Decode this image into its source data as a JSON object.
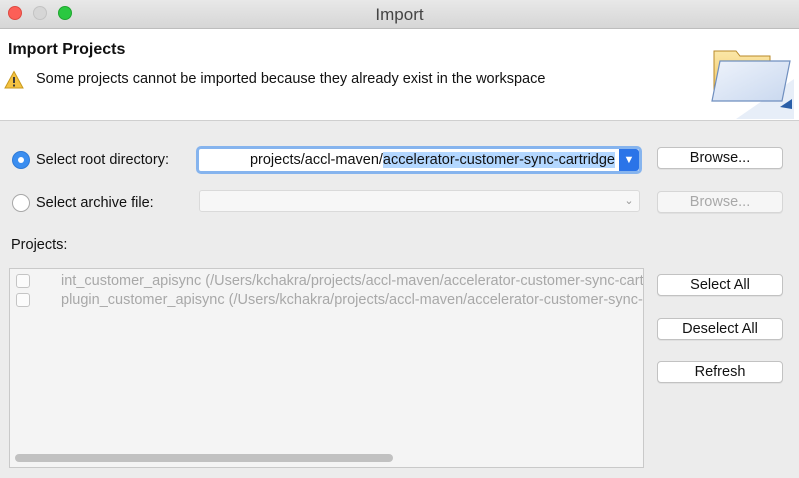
{
  "window": {
    "title": "Import"
  },
  "header": {
    "title": "Import Projects",
    "message": "Some projects cannot be imported because they already exist in the workspace"
  },
  "root_dir": {
    "label": "Select root directory:",
    "value_prefix": "projects/accl-maven/",
    "value_selected": "accelerator-customer-sync-cartridge",
    "browse": "Browse..."
  },
  "archive": {
    "label": "Select archive file:",
    "value": "",
    "browse": "Browse..."
  },
  "projects": {
    "label": "Projects:",
    "rows": [
      "int_customer_apisync (/Users/kchakra/projects/accl-maven/accelerator-customer-sync-cartridge)",
      "plugin_customer_apisync (/Users/kchakra/projects/accl-maven/accelerator-customer-sync-cartridge)"
    ]
  },
  "actions": {
    "select_all": "Select All",
    "deselect_all": "Deselect All",
    "refresh": "Refresh"
  },
  "colors": {
    "accent": "#3b8ef0",
    "selection": "#b3d7ff",
    "focus_ring": "#86b4ee"
  }
}
